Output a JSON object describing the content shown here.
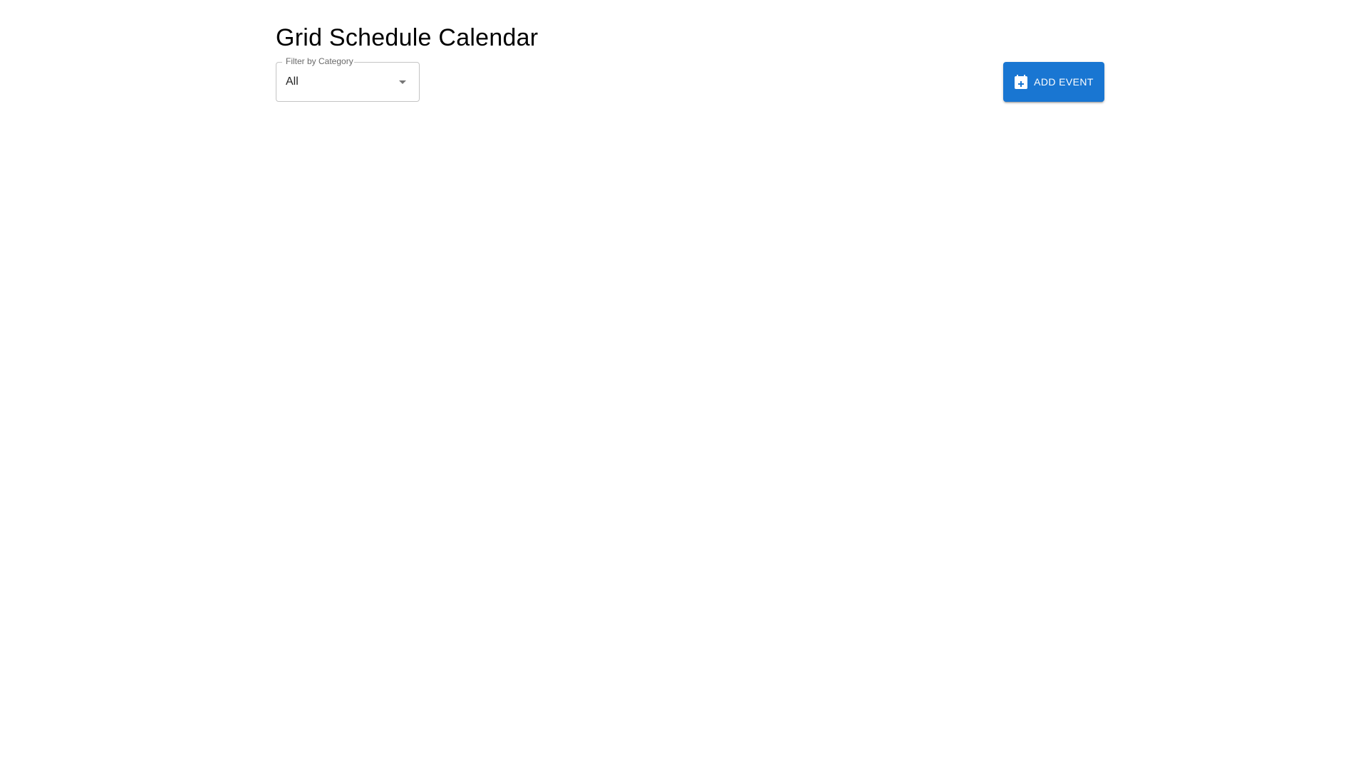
{
  "page": {
    "title": "Grid Schedule Calendar"
  },
  "filter": {
    "label": "Filter by Category",
    "value": "All",
    "icon": "arrow-drop-down-icon"
  },
  "actions": {
    "add_event_label": "ADD EVENT",
    "add_event_icon": "calendar-add-icon"
  },
  "colors": {
    "primary": "#1976d2",
    "text": "#000000",
    "border": "#c4c4c4",
    "background": "#ffffff"
  }
}
